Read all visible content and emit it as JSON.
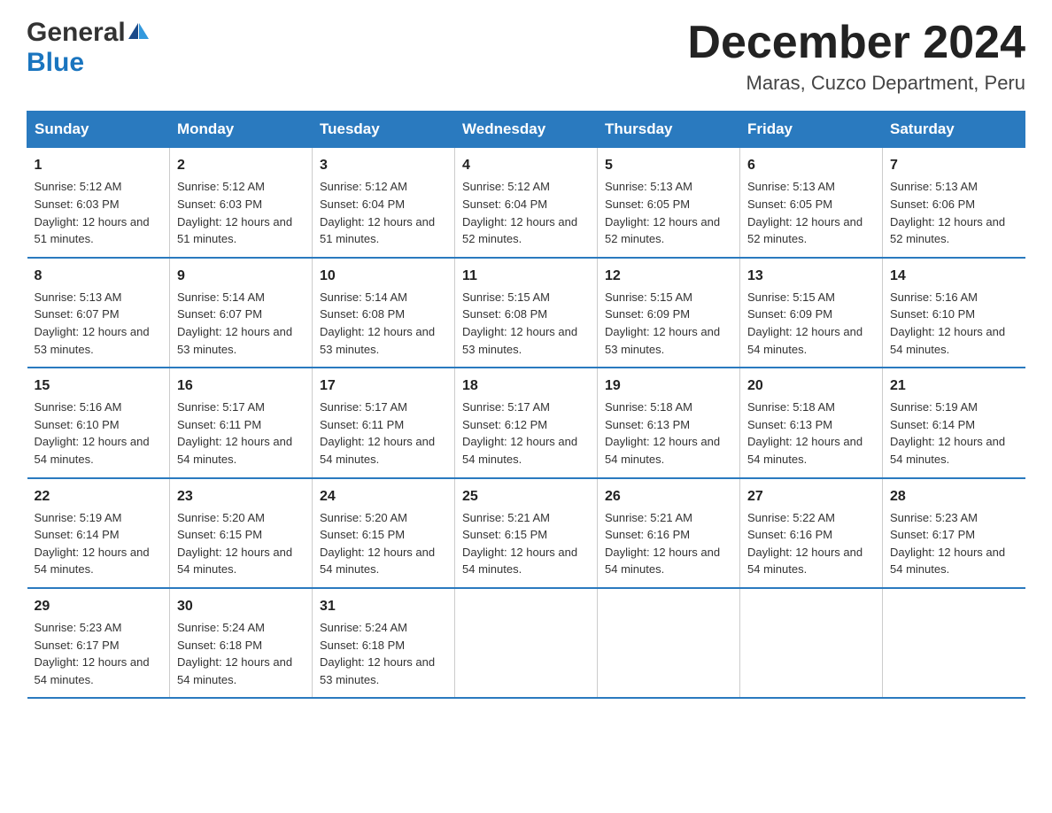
{
  "header": {
    "logo_general": "General",
    "logo_blue": "Blue",
    "month_title": "December 2024",
    "location": "Maras, Cuzco Department, Peru"
  },
  "calendar": {
    "days_of_week": [
      "Sunday",
      "Monday",
      "Tuesday",
      "Wednesday",
      "Thursday",
      "Friday",
      "Saturday"
    ],
    "weeks": [
      [
        {
          "day": "1",
          "sunrise": "5:12 AM",
          "sunset": "6:03 PM",
          "daylight": "12 hours and 51 minutes."
        },
        {
          "day": "2",
          "sunrise": "5:12 AM",
          "sunset": "6:03 PM",
          "daylight": "12 hours and 51 minutes."
        },
        {
          "day": "3",
          "sunrise": "5:12 AM",
          "sunset": "6:04 PM",
          "daylight": "12 hours and 51 minutes."
        },
        {
          "day": "4",
          "sunrise": "5:12 AM",
          "sunset": "6:04 PM",
          "daylight": "12 hours and 52 minutes."
        },
        {
          "day": "5",
          "sunrise": "5:13 AM",
          "sunset": "6:05 PM",
          "daylight": "12 hours and 52 minutes."
        },
        {
          "day": "6",
          "sunrise": "5:13 AM",
          "sunset": "6:05 PM",
          "daylight": "12 hours and 52 minutes."
        },
        {
          "day": "7",
          "sunrise": "5:13 AM",
          "sunset": "6:06 PM",
          "daylight": "12 hours and 52 minutes."
        }
      ],
      [
        {
          "day": "8",
          "sunrise": "5:13 AM",
          "sunset": "6:07 PM",
          "daylight": "12 hours and 53 minutes."
        },
        {
          "day": "9",
          "sunrise": "5:14 AM",
          "sunset": "6:07 PM",
          "daylight": "12 hours and 53 minutes."
        },
        {
          "day": "10",
          "sunrise": "5:14 AM",
          "sunset": "6:08 PM",
          "daylight": "12 hours and 53 minutes."
        },
        {
          "day": "11",
          "sunrise": "5:15 AM",
          "sunset": "6:08 PM",
          "daylight": "12 hours and 53 minutes."
        },
        {
          "day": "12",
          "sunrise": "5:15 AM",
          "sunset": "6:09 PM",
          "daylight": "12 hours and 53 minutes."
        },
        {
          "day": "13",
          "sunrise": "5:15 AM",
          "sunset": "6:09 PM",
          "daylight": "12 hours and 54 minutes."
        },
        {
          "day": "14",
          "sunrise": "5:16 AM",
          "sunset": "6:10 PM",
          "daylight": "12 hours and 54 minutes."
        }
      ],
      [
        {
          "day": "15",
          "sunrise": "5:16 AM",
          "sunset": "6:10 PM",
          "daylight": "12 hours and 54 minutes."
        },
        {
          "day": "16",
          "sunrise": "5:17 AM",
          "sunset": "6:11 PM",
          "daylight": "12 hours and 54 minutes."
        },
        {
          "day": "17",
          "sunrise": "5:17 AM",
          "sunset": "6:11 PM",
          "daylight": "12 hours and 54 minutes."
        },
        {
          "day": "18",
          "sunrise": "5:17 AM",
          "sunset": "6:12 PM",
          "daylight": "12 hours and 54 minutes."
        },
        {
          "day": "19",
          "sunrise": "5:18 AM",
          "sunset": "6:13 PM",
          "daylight": "12 hours and 54 minutes."
        },
        {
          "day": "20",
          "sunrise": "5:18 AM",
          "sunset": "6:13 PM",
          "daylight": "12 hours and 54 minutes."
        },
        {
          "day": "21",
          "sunrise": "5:19 AM",
          "sunset": "6:14 PM",
          "daylight": "12 hours and 54 minutes."
        }
      ],
      [
        {
          "day": "22",
          "sunrise": "5:19 AM",
          "sunset": "6:14 PM",
          "daylight": "12 hours and 54 minutes."
        },
        {
          "day": "23",
          "sunrise": "5:20 AM",
          "sunset": "6:15 PM",
          "daylight": "12 hours and 54 minutes."
        },
        {
          "day": "24",
          "sunrise": "5:20 AM",
          "sunset": "6:15 PM",
          "daylight": "12 hours and 54 minutes."
        },
        {
          "day": "25",
          "sunrise": "5:21 AM",
          "sunset": "6:15 PM",
          "daylight": "12 hours and 54 minutes."
        },
        {
          "day": "26",
          "sunrise": "5:21 AM",
          "sunset": "6:16 PM",
          "daylight": "12 hours and 54 minutes."
        },
        {
          "day": "27",
          "sunrise": "5:22 AM",
          "sunset": "6:16 PM",
          "daylight": "12 hours and 54 minutes."
        },
        {
          "day": "28",
          "sunrise": "5:23 AM",
          "sunset": "6:17 PM",
          "daylight": "12 hours and 54 minutes."
        }
      ],
      [
        {
          "day": "29",
          "sunrise": "5:23 AM",
          "sunset": "6:17 PM",
          "daylight": "12 hours and 54 minutes."
        },
        {
          "day": "30",
          "sunrise": "5:24 AM",
          "sunset": "6:18 PM",
          "daylight": "12 hours and 54 minutes."
        },
        {
          "day": "31",
          "sunrise": "5:24 AM",
          "sunset": "6:18 PM",
          "daylight": "12 hours and 53 minutes."
        },
        null,
        null,
        null,
        null
      ]
    ]
  }
}
